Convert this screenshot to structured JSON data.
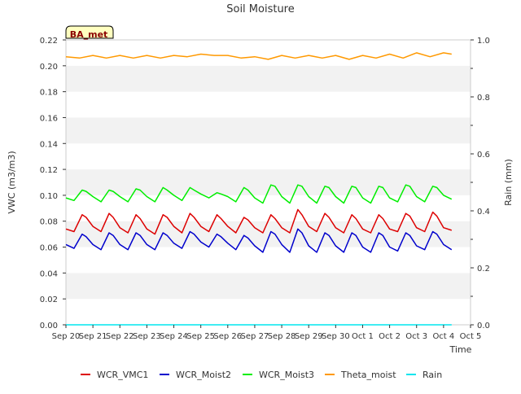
{
  "chart_data": {
    "type": "line",
    "title": "Soil Moisture",
    "xlabel": "Time",
    "ylabel": "VWC (m3/m3)",
    "y2label": "Rain (mm)",
    "station_badge": "BA_met",
    "xlim": [
      0,
      15
    ],
    "ylim": [
      0,
      0.22
    ],
    "y2lim": [
      0,
      1.0
    ],
    "x_ticks": [
      {
        "x": 0,
        "label": "Sep 20"
      },
      {
        "x": 1,
        "label": "Sep 21"
      },
      {
        "x": 2,
        "label": "Sep 22"
      },
      {
        "x": 3,
        "label": "Sep 23"
      },
      {
        "x": 4,
        "label": "Sep 24"
      },
      {
        "x": 5,
        "label": "Sep 25"
      },
      {
        "x": 6,
        "label": "Sep 26"
      },
      {
        "x": 7,
        "label": "Sep 27"
      },
      {
        "x": 8,
        "label": "Sep 28"
      },
      {
        "x": 9,
        "label": "Sep 29"
      },
      {
        "x": 10,
        "label": "Sep 30"
      },
      {
        "x": 11,
        "label": "Oct 1"
      },
      {
        "x": 12,
        "label": "Oct 2"
      },
      {
        "x": 13,
        "label": "Oct 3"
      },
      {
        "x": 14,
        "label": "Oct 4"
      },
      {
        "x": 15,
        "label": "Oct 5"
      }
    ],
    "y_ticks": [
      "0.00",
      "0.02",
      "0.04",
      "0.06",
      "0.08",
      "0.10",
      "0.12",
      "0.14",
      "0.16",
      "0.18",
      "0.20",
      "0.22"
    ],
    "y2_ticks": [
      "0.0",
      "0.2",
      "0.4",
      "0.6",
      "0.8",
      "1.0"
    ],
    "grid": "horizontal bands",
    "legend_position": "bottom",
    "series": [
      {
        "name": "WCR_VMC1",
        "color": "#dd0000",
        "axis": "left",
        "x": [
          0,
          0.3,
          0.6,
          0.75,
          1,
          1.3,
          1.6,
          1.75,
          2,
          2.3,
          2.6,
          2.75,
          3,
          3.3,
          3.6,
          3.75,
          4,
          4.3,
          4.6,
          4.75,
          5,
          5.3,
          5.6,
          5.75,
          6,
          6.3,
          6.6,
          6.75,
          7,
          7.3,
          7.6,
          7.75,
          8,
          8.3,
          8.6,
          8.75,
          9,
          9.3,
          9.6,
          9.75,
          10,
          10.3,
          10.6,
          10.75,
          11,
          11.3,
          11.6,
          11.75,
          12,
          12.3,
          12.6,
          12.75,
          13,
          13.3,
          13.6,
          13.75,
          14,
          14.3
        ],
        "values": [
          0.074,
          0.072,
          0.085,
          0.083,
          0.076,
          0.072,
          0.086,
          0.083,
          0.075,
          0.071,
          0.085,
          0.082,
          0.074,
          0.07,
          0.085,
          0.083,
          0.076,
          0.071,
          0.086,
          0.083,
          0.076,
          0.072,
          0.085,
          0.082,
          0.076,
          0.071,
          0.083,
          0.081,
          0.075,
          0.071,
          0.085,
          0.082,
          0.075,
          0.071,
          0.089,
          0.085,
          0.076,
          0.072,
          0.086,
          0.083,
          0.075,
          0.071,
          0.085,
          0.082,
          0.074,
          0.071,
          0.085,
          0.082,
          0.074,
          0.072,
          0.086,
          0.084,
          0.075,
          0.072,
          0.087,
          0.084,
          0.075,
          0.073
        ]
      },
      {
        "name": "WCR_Moist2",
        "color": "#0000cc",
        "axis": "left",
        "x": [
          0,
          0.3,
          0.6,
          0.75,
          1,
          1.3,
          1.6,
          1.75,
          2,
          2.3,
          2.6,
          2.75,
          3,
          3.3,
          3.6,
          3.75,
          4,
          4.3,
          4.6,
          4.75,
          5,
          5.3,
          5.6,
          5.75,
          6,
          6.3,
          6.6,
          6.75,
          7,
          7.3,
          7.6,
          7.75,
          8,
          8.3,
          8.6,
          8.75,
          9,
          9.3,
          9.6,
          9.75,
          10,
          10.3,
          10.6,
          10.75,
          11,
          11.3,
          11.6,
          11.75,
          12,
          12.3,
          12.6,
          12.75,
          13,
          13.3,
          13.6,
          13.75,
          14,
          14.3
        ],
        "values": [
          0.062,
          0.059,
          0.07,
          0.068,
          0.062,
          0.058,
          0.071,
          0.069,
          0.062,
          0.058,
          0.071,
          0.069,
          0.062,
          0.058,
          0.071,
          0.069,
          0.063,
          0.059,
          0.072,
          0.07,
          0.064,
          0.06,
          0.07,
          0.068,
          0.063,
          0.058,
          0.069,
          0.067,
          0.061,
          0.056,
          0.072,
          0.07,
          0.062,
          0.056,
          0.074,
          0.071,
          0.061,
          0.056,
          0.071,
          0.069,
          0.061,
          0.056,
          0.071,
          0.069,
          0.06,
          0.056,
          0.071,
          0.069,
          0.06,
          0.057,
          0.071,
          0.069,
          0.061,
          0.058,
          0.072,
          0.07,
          0.062,
          0.058
        ]
      },
      {
        "name": "WCR_Moist3",
        "color": "#00ee00",
        "axis": "left",
        "x": [
          0,
          0.3,
          0.6,
          0.75,
          1,
          1.3,
          1.6,
          1.75,
          2,
          2.3,
          2.6,
          2.75,
          3,
          3.3,
          3.6,
          3.75,
          4,
          4.3,
          4.6,
          4.75,
          5,
          5.3,
          5.6,
          5.75,
          6,
          6.3,
          6.6,
          6.75,
          7,
          7.3,
          7.6,
          7.75,
          8,
          8.3,
          8.6,
          8.75,
          9,
          9.3,
          9.6,
          9.75,
          10,
          10.3,
          10.6,
          10.75,
          11,
          11.3,
          11.6,
          11.75,
          12,
          12.3,
          12.6,
          12.75,
          13,
          13.3,
          13.6,
          13.75,
          14,
          14.3
        ],
        "values": [
          0.098,
          0.096,
          0.104,
          0.103,
          0.099,
          0.095,
          0.104,
          0.103,
          0.099,
          0.095,
          0.105,
          0.104,
          0.099,
          0.095,
          0.106,
          0.104,
          0.1,
          0.096,
          0.106,
          0.104,
          0.101,
          0.098,
          0.102,
          0.101,
          0.099,
          0.095,
          0.106,
          0.104,
          0.098,
          0.094,
          0.108,
          0.107,
          0.099,
          0.094,
          0.108,
          0.107,
          0.099,
          0.094,
          0.107,
          0.106,
          0.099,
          0.094,
          0.107,
          0.106,
          0.098,
          0.094,
          0.107,
          0.106,
          0.098,
          0.095,
          0.108,
          0.107,
          0.099,
          0.095,
          0.107,
          0.106,
          0.1,
          0.097
        ]
      },
      {
        "name": "Theta_moist",
        "color": "#ff9900",
        "axis": "left",
        "x": [
          0,
          0.5,
          1,
          1.5,
          2,
          2.5,
          3,
          3.5,
          4,
          4.5,
          5,
          5.5,
          6,
          6.5,
          7,
          7.5,
          8,
          8.5,
          9,
          9.5,
          10,
          10.5,
          11,
          11.5,
          12,
          12.5,
          13,
          13.5,
          14,
          14.3
        ],
        "values": [
          0.207,
          0.206,
          0.208,
          0.206,
          0.208,
          0.206,
          0.208,
          0.206,
          0.208,
          0.207,
          0.209,
          0.208,
          0.208,
          0.206,
          0.207,
          0.205,
          0.208,
          0.206,
          0.208,
          0.206,
          0.208,
          0.205,
          0.208,
          0.206,
          0.209,
          0.206,
          0.21,
          0.207,
          0.21,
          0.209
        ]
      },
      {
        "name": "Rain",
        "color": "#00e5ee",
        "axis": "right",
        "x": [
          0,
          14.3
        ],
        "values": [
          0,
          0
        ]
      }
    ]
  }
}
